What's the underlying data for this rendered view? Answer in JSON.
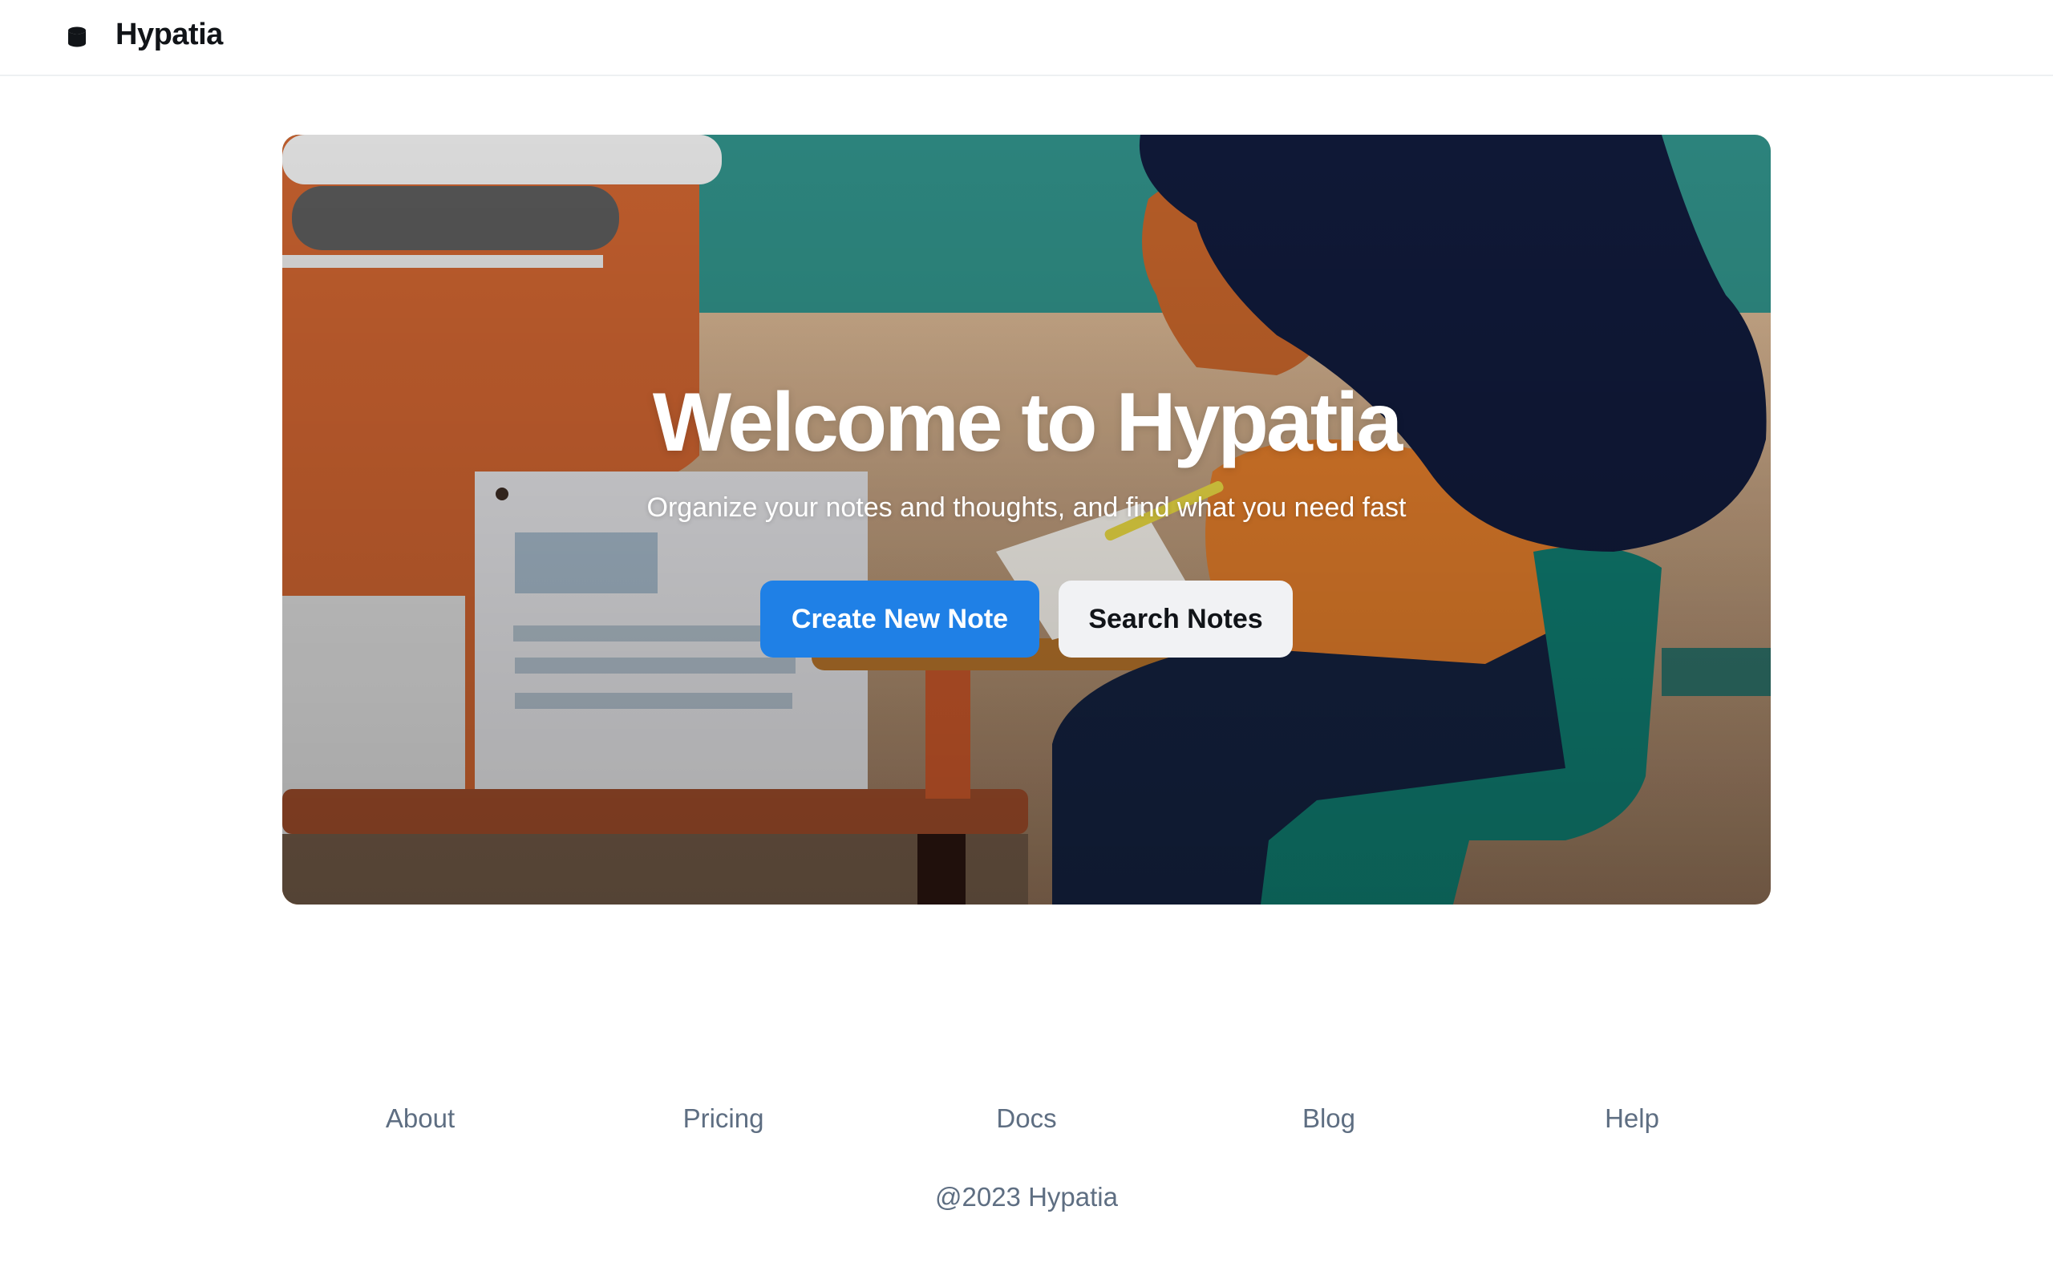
{
  "header": {
    "logo_icon": "database-icon",
    "brand": "Hypatia"
  },
  "hero": {
    "title": "Welcome to Hypatia",
    "subtitle": "Organize your notes and thoughts, and find what you need fast",
    "primary_button": "Create New Note",
    "secondary_button": "Search Notes",
    "image": "illustration of a woman writing notes at a desk"
  },
  "footer": {
    "links": [
      "About",
      "Pricing",
      "Docs",
      "Blog",
      "Help"
    ],
    "copyright": "@2023 Hypatia"
  },
  "colors": {
    "primary": "#1f80e6",
    "secondary_button_bg": "#f1f2f4",
    "footer_text": "#5e6e82",
    "text": "#111418"
  }
}
